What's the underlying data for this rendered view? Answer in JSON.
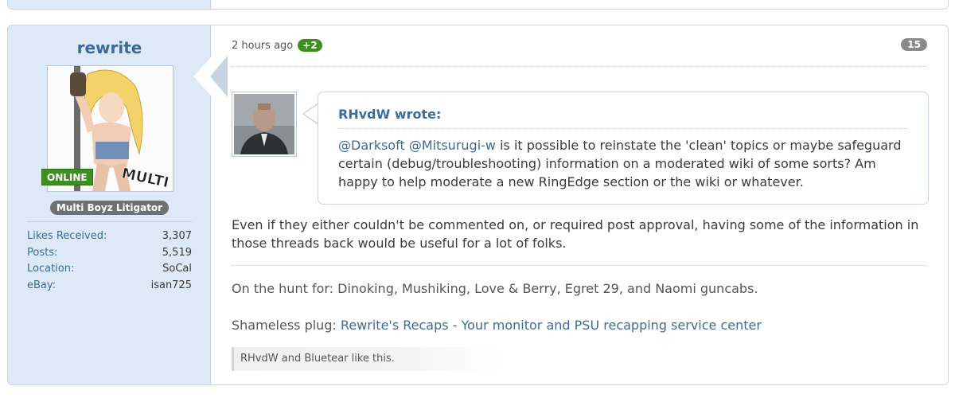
{
  "post": {
    "author": {
      "username": "rewrite",
      "online_label": "ONLINE",
      "user_title": "Multi Boyz Litigator",
      "avatar_caption": "MULTI BOYZ",
      "stats": [
        {
          "label": "Likes Received:",
          "value": "3,307"
        },
        {
          "label": "Posts:",
          "value": "5,519"
        },
        {
          "label": "Location:",
          "value": "SoCal"
        },
        {
          "label": "eBay:",
          "value": "isan725"
        }
      ]
    },
    "meta": {
      "timestamp": "2 hours ago",
      "likes_badge": "+2",
      "post_number": "15"
    },
    "quote": {
      "author_line": "RHvdW wrote:",
      "mention_1": "@Darksoft",
      "mention_2": "@Mitsurugi-w",
      "text": " is it possible to reinstate the 'clean' topics or maybe safeguard certain (debug/troubleshooting) information on a moderated wiki of some sorts? Am happy to help moderate a new RingEdge section or the wiki or whatever."
    },
    "body": "Even if they either couldn't be commented on, or required post approval, having some of the information in those threads back would be useful for a lot of folks.",
    "signature": {
      "line1": "On the hunt for: Dinoking, Mushiking, Love & Berry, Egret 29, and Naomi guncabs.",
      "plug_prefix": "Shameless plug: ",
      "plug_link": "Rewrite's Recaps - Your monitor and PSU recapping service center"
    },
    "likes_summary": "RHvdW and Bluetear like this."
  },
  "colors": {
    "sidebar_bg": "#dde9f6",
    "link": "#3e6a96",
    "online_green": "#3d8f1e",
    "badge_gray": "#8a8a8a"
  }
}
